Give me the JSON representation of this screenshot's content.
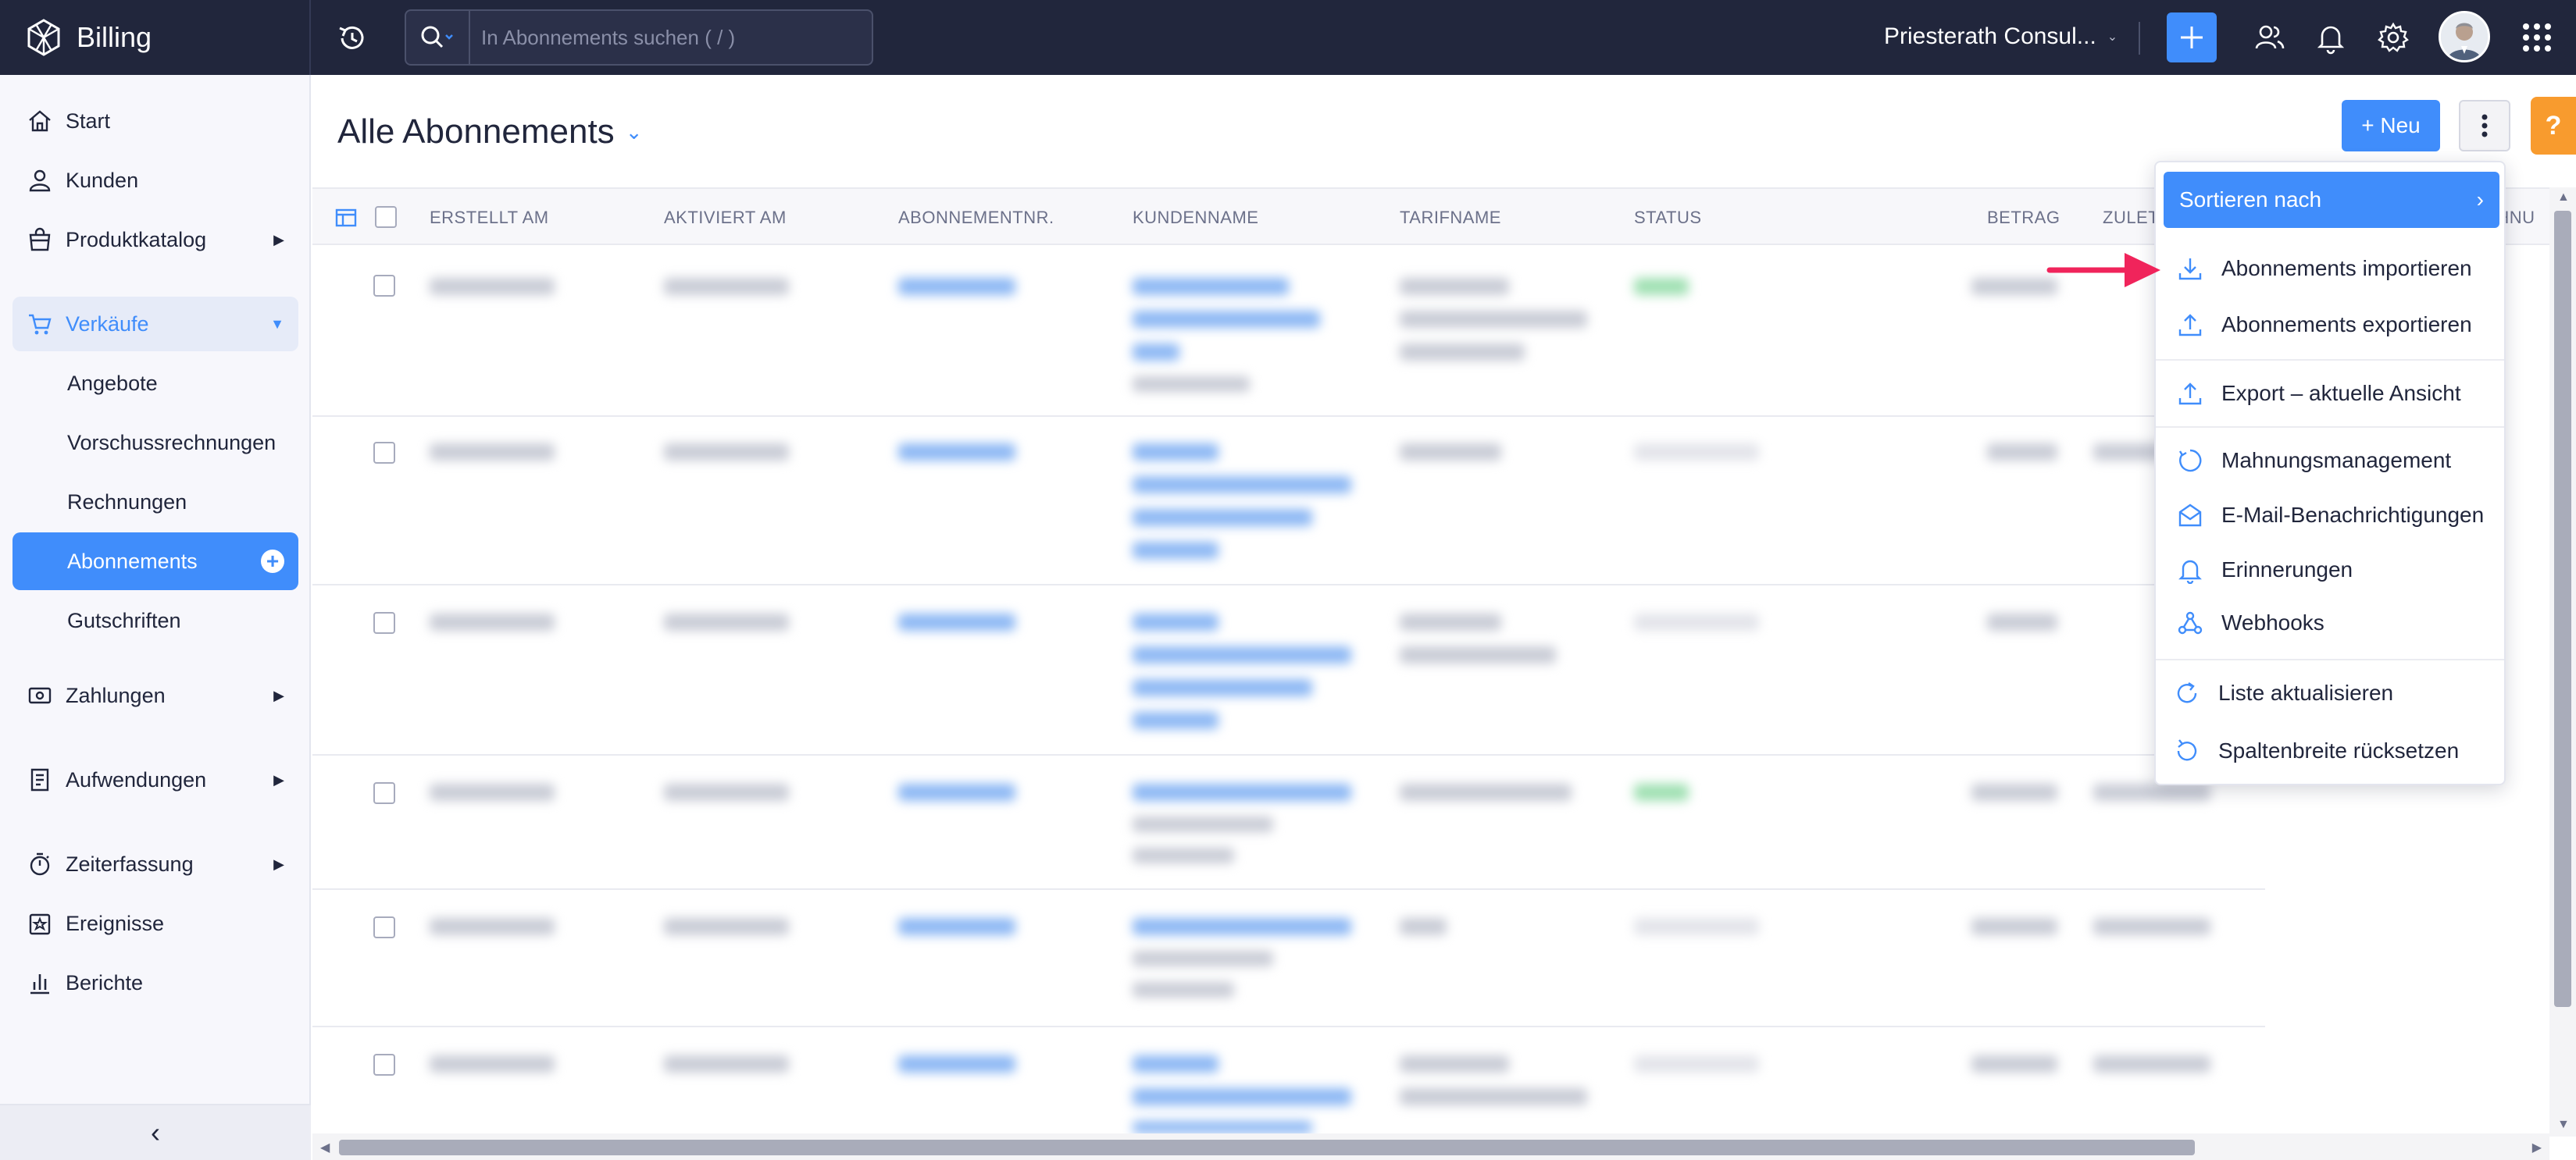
{
  "app": {
    "name": "Billing"
  },
  "search": {
    "placeholder": "In Abonnements suchen ( / )"
  },
  "header": {
    "org": "Priesterath Consul..."
  },
  "sidebar": {
    "items": [
      {
        "label": "Start"
      },
      {
        "label": "Kunden"
      },
      {
        "label": "Produktkatalog"
      },
      {
        "label": "Verkäufe"
      },
      {
        "label": "Zahlungen"
      },
      {
        "label": "Aufwendungen"
      },
      {
        "label": "Zeiterfassung"
      },
      {
        "label": "Ereignisse"
      },
      {
        "label": "Berichte"
      }
    ],
    "sub_items": [
      {
        "label": "Angebote"
      },
      {
        "label": "Vorschussrechnungen"
      },
      {
        "label": "Rechnungen"
      },
      {
        "label": "Abonnements"
      },
      {
        "label": "Gutschriften"
      }
    ],
    "collapse_glyph": "‹"
  },
  "page": {
    "title": "Alle Abonnements",
    "new_label": "+ Neu",
    "help": "?"
  },
  "table": {
    "columns": [
      "ERSTELLT AM",
      "AKTIVIERT AM",
      "ABONNEMENTNR.",
      "KUNDENNAME",
      "TARIFNAME",
      "STATUS",
      "BETRAG",
      "ZULET",
      "CHNU"
    ]
  },
  "menu": {
    "sort": "Sortieren nach",
    "items": [
      {
        "label": "Abonnements importieren"
      },
      {
        "label": "Abonnements exportieren"
      },
      {
        "label": "Export – aktuelle Ansicht"
      },
      {
        "label": "Mahnungsmanagement"
      },
      {
        "label": "E-Mail-Benachrichtigungen"
      },
      {
        "label": "Erinnerungen"
      },
      {
        "label": "Webhooks"
      },
      {
        "label": "Liste aktualisieren"
      },
      {
        "label": "Spaltenbreite rücksetzen"
      }
    ]
  },
  "colors": {
    "accent": "#408dfb",
    "topbar": "#21263c",
    "help": "#f89b2e",
    "annotation": "#f0245b"
  }
}
